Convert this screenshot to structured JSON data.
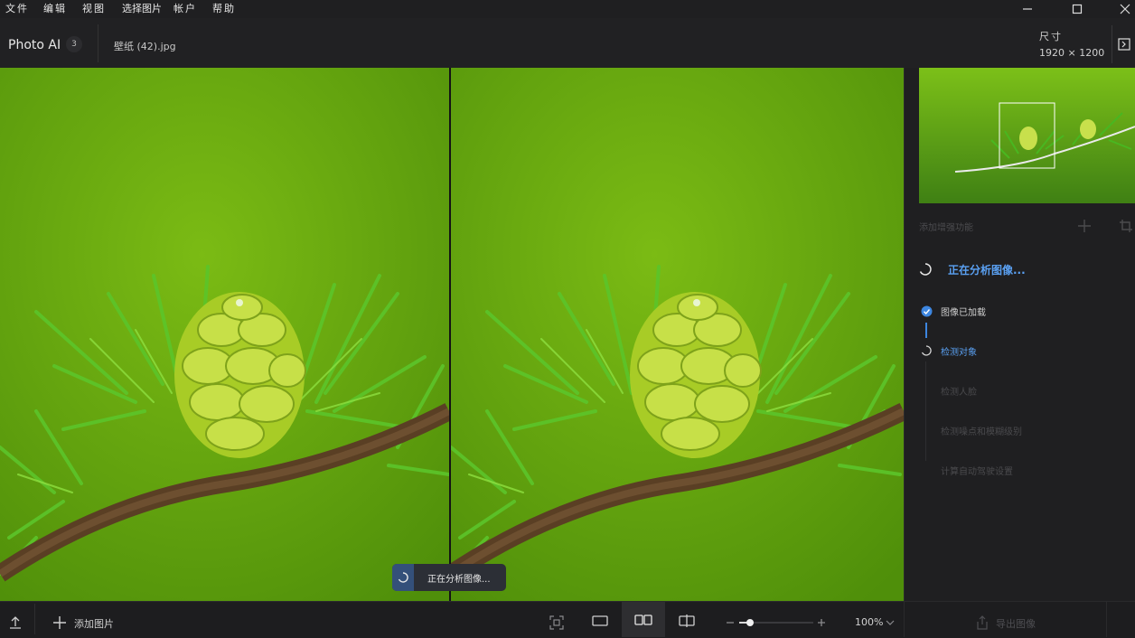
{
  "menu": [
    "文件",
    "编辑",
    "视图",
    "选择图片",
    "帐户",
    "帮助"
  ],
  "header": {
    "app_name": "Photo AI",
    "image_count": "3",
    "file_name": "壁纸 (42).jpg",
    "dimensions_label": "尺寸",
    "dimensions_value": "1920 × 1200"
  },
  "toast": {
    "text": "正在分析图像..."
  },
  "panel": {
    "add_feature": "添加增强功能",
    "status_title": "正在分析图像...",
    "steps": [
      {
        "label": "图像已加载",
        "state": "done"
      },
      {
        "label": "检测对象",
        "state": "active"
      },
      {
        "label": "检测人脸",
        "state": "pending"
      },
      {
        "label": "检测噪点和模糊级别",
        "state": "pending"
      },
      {
        "label": "计算自动驾驶设置",
        "state": "pending"
      }
    ],
    "export_label": "导出图像"
  },
  "bottom": {
    "add_image": "添加图片",
    "zoom": "100%",
    "zoom_level": 0.15
  },
  "colors": {
    "accent": "#5aa0f2",
    "background": "#1c1c1e",
    "image_green": "#6fab10"
  },
  "icons": [
    "minimize-icon",
    "maximize-icon",
    "close-icon",
    "panel-toggle-icon",
    "spinner-icon",
    "check-circle-icon",
    "upload-icon",
    "plus-icon",
    "crop-icon",
    "fit-screen-icon",
    "single-view-icon",
    "side-by-side-icon",
    "split-view-icon",
    "zoom-out-icon",
    "zoom-in-icon",
    "chevron-down-icon",
    "export-icon"
  ]
}
